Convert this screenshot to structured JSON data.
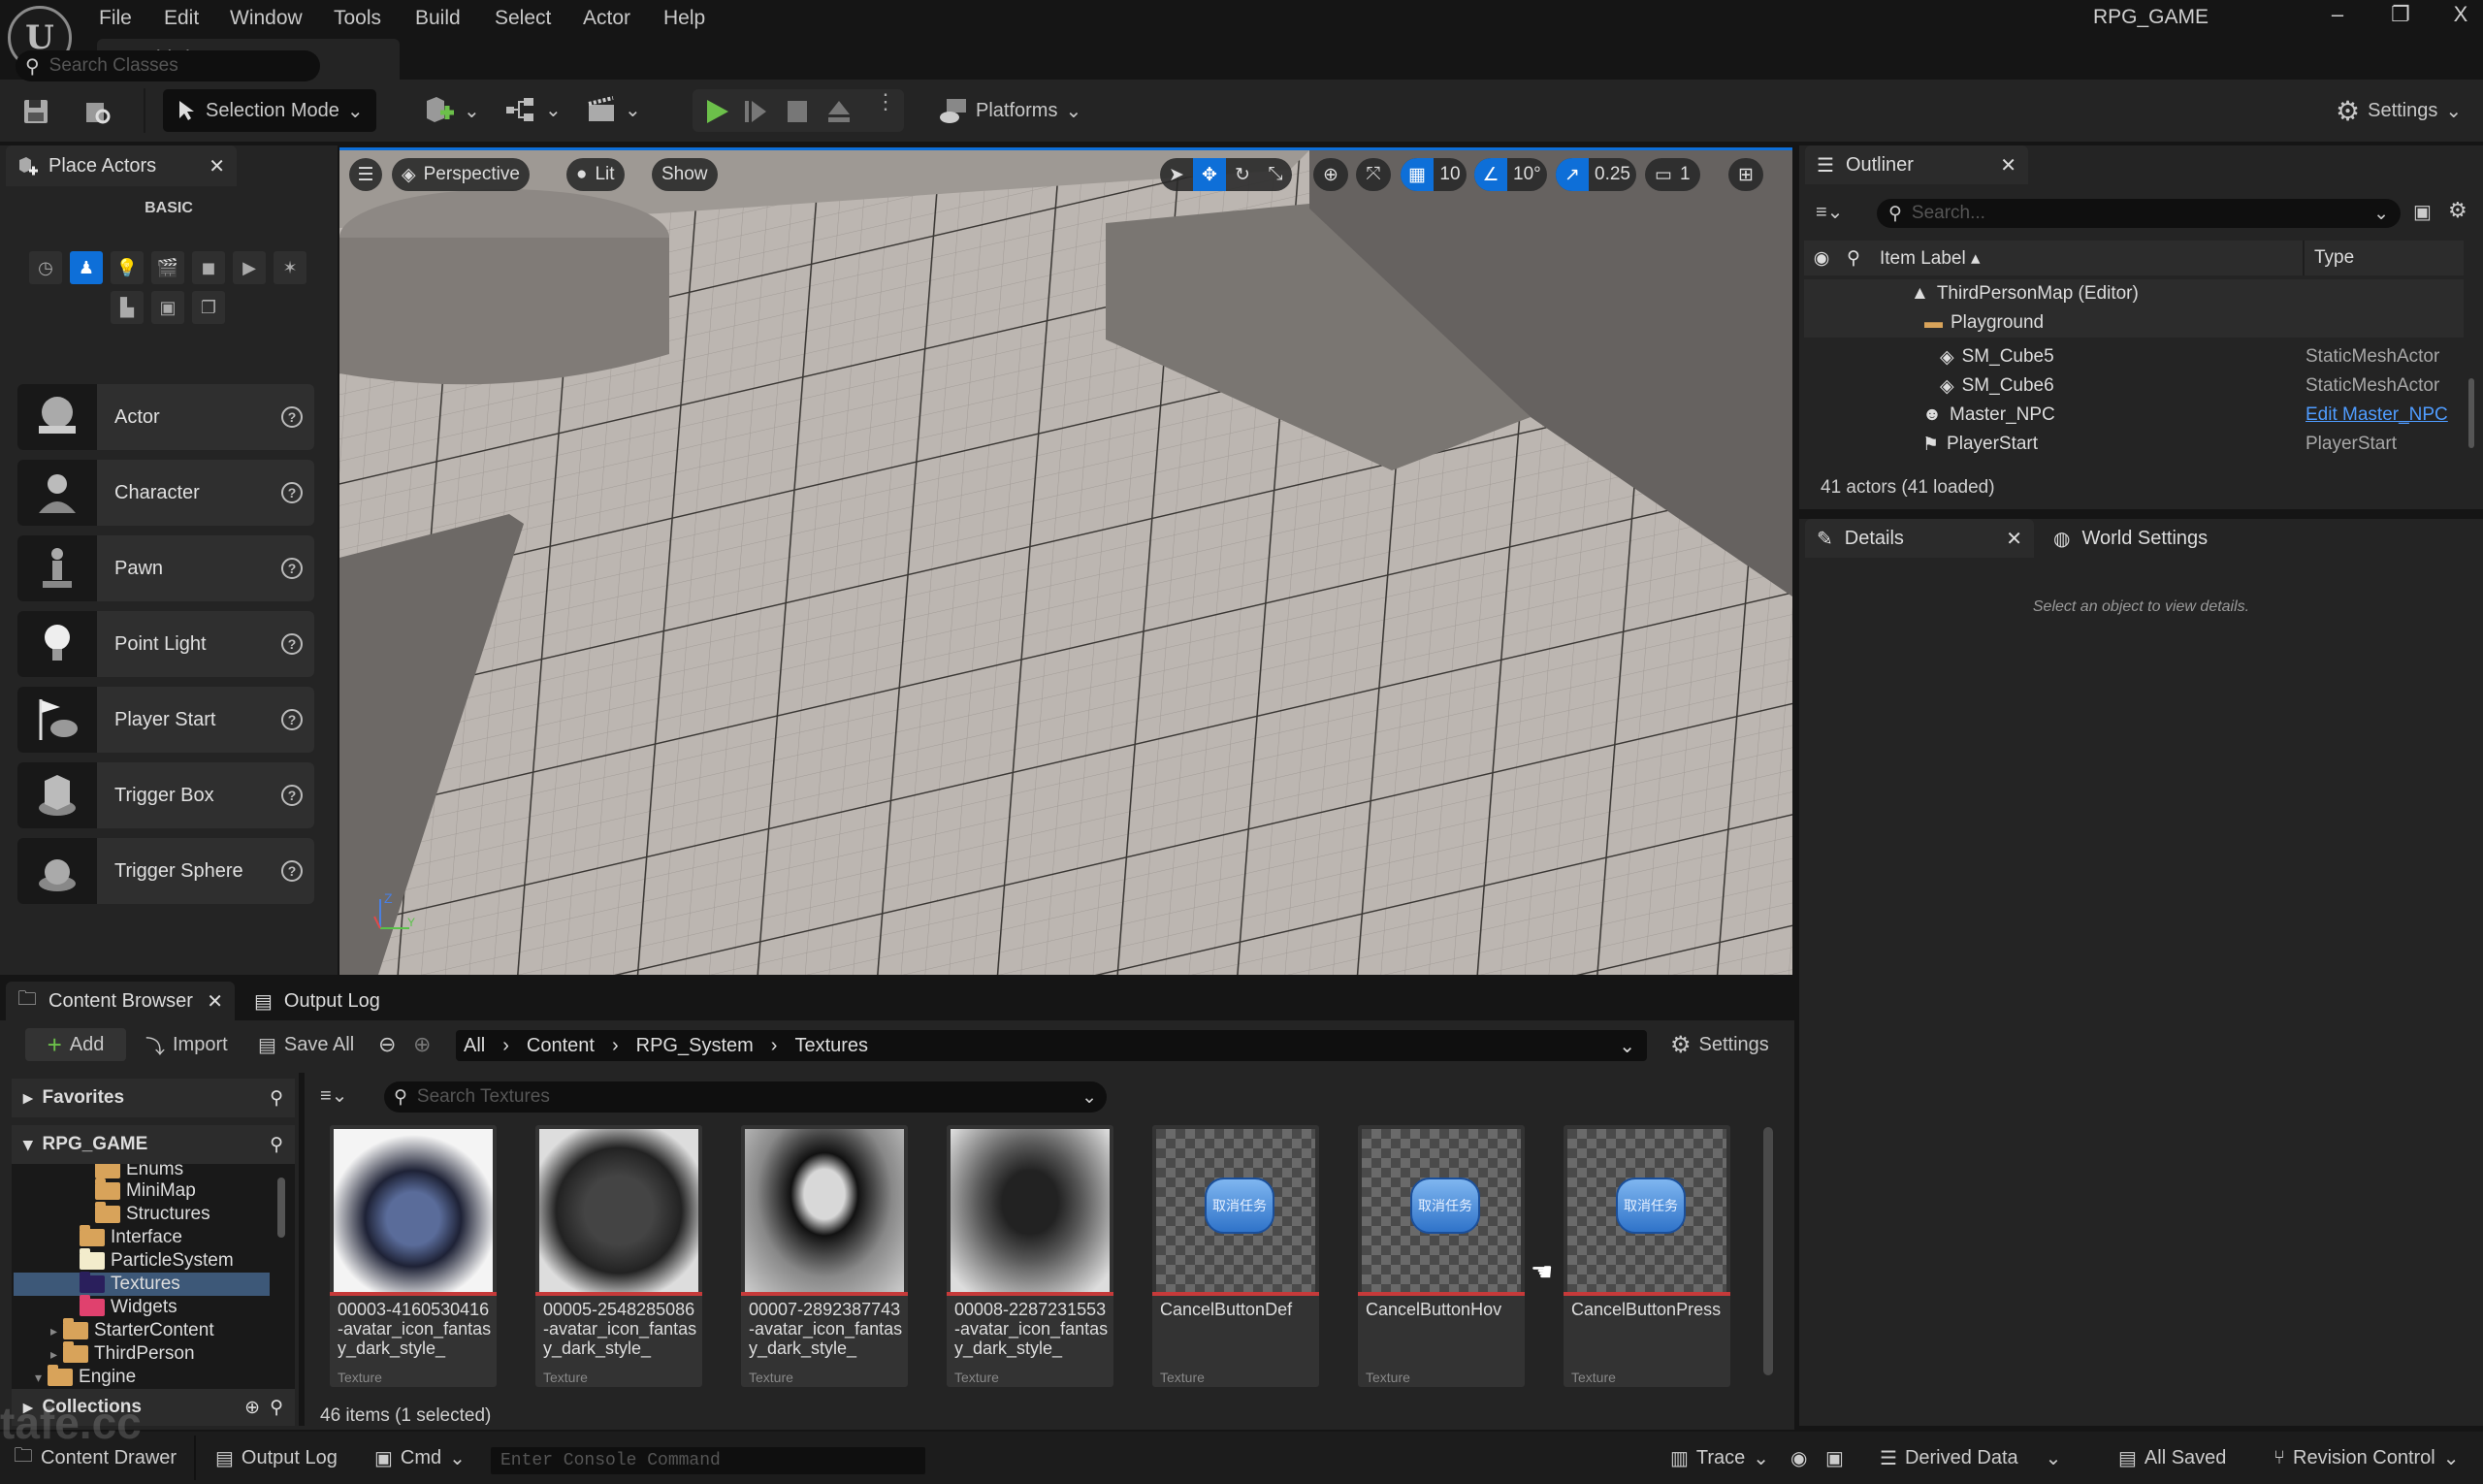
{
  "window": {
    "app_title": "RPG_GAME",
    "map_tab": "ThirdPersonMap",
    "controls": {
      "minimize": "–",
      "restore": "❐",
      "close": "X"
    }
  },
  "menu": [
    "File",
    "Edit",
    "Window",
    "Tools",
    "Build",
    "Select",
    "Actor",
    "Help"
  ],
  "toolbar": {
    "selection_mode": "Selection Mode",
    "platforms": "Platforms",
    "settings": "Settings"
  },
  "place_actors": {
    "title": "Place Actors",
    "search_placeholder": "Search Classes",
    "category_label": "BASIC",
    "categories": [
      "recent",
      "basic",
      "lights",
      "cinematic",
      "visual-effects",
      "volumes",
      "all-classes",
      "geometry",
      "shapes",
      "place"
    ],
    "items": [
      {
        "label": "Actor",
        "icon": "sphere-icon"
      },
      {
        "label": "Character",
        "icon": "character-icon"
      },
      {
        "label": "Pawn",
        "icon": "pawn-icon"
      },
      {
        "label": "Point Light",
        "icon": "lightbulb-icon"
      },
      {
        "label": "Player Start",
        "icon": "player-start-icon"
      },
      {
        "label": "Trigger Box",
        "icon": "trigger-box-icon"
      },
      {
        "label": "Trigger Sphere",
        "icon": "trigger-sphere-icon"
      }
    ]
  },
  "viewport": {
    "view_mode": "Perspective",
    "lighting": "Lit",
    "show": "Show",
    "grid_snap": "10",
    "rotation_snap": "10°",
    "scale_snap": "0.25",
    "camera_speed": "1",
    "axis_labels": {
      "z": "Z",
      "y": "Y"
    }
  },
  "outliner": {
    "title": "Outliner",
    "search_placeholder": "Search...",
    "columns": {
      "label": "Item Label",
      "type": "Type"
    },
    "rows": [
      {
        "label": "ThirdPersonMap (Editor)",
        "type": "",
        "icon": "map-icon"
      },
      {
        "label": "Playground",
        "type": "",
        "icon": "folder-icon"
      },
      {
        "label": "SM_Cube5",
        "type": "StaticMeshActor",
        "icon": "static-mesh-icon"
      },
      {
        "label": "SM_Cube6",
        "type": "StaticMeshActor",
        "icon": "static-mesh-icon"
      },
      {
        "label": "Master_NPC",
        "type": "Edit Master_NPC",
        "icon": "character-icon"
      },
      {
        "label": "PlayerStart",
        "type": "PlayerStart",
        "icon": "player-start-icon"
      }
    ],
    "actor_count": "41 actors (41 loaded)"
  },
  "details": {
    "tab": "Details",
    "world_settings_tab": "World Settings",
    "empty_message": "Select an object to view details."
  },
  "content_browser": {
    "tab": "Content Browser",
    "output_log_tab": "Output Log",
    "add": "Add",
    "import": "Import",
    "save_all": "Save All",
    "path": [
      "All",
      "Content",
      "RPG_System",
      "Textures"
    ],
    "settings": "Settings",
    "search_placeholder": "Search Textures",
    "favorites": "Favorites",
    "project": "RPG_GAME",
    "collections": "Collections",
    "tree": [
      {
        "label": "Enums",
        "color": "#d8a35a",
        "indent": 3
      },
      {
        "label": "MiniMap",
        "color": "#d8a35a",
        "indent": 3
      },
      {
        "label": "Structures",
        "color": "#d8a35a",
        "indent": 3
      },
      {
        "label": "Interface",
        "color": "#d8a35a",
        "indent": 2
      },
      {
        "label": "ParticleSystem",
        "color": "#f3eccc",
        "indent": 2
      },
      {
        "label": "Textures",
        "color": "#2a1f5c",
        "indent": 2,
        "selected": true
      },
      {
        "label": "Widgets",
        "color": "#e0416e",
        "indent": 2
      },
      {
        "label": "StarterContent",
        "color": "#d8a35a",
        "indent": 1,
        "expandable": true
      },
      {
        "label": "ThirdPerson",
        "color": "#d8a35a",
        "indent": 1,
        "expandable": true
      },
      {
        "label": "Engine",
        "color": "#d8a35a",
        "indent": 0,
        "expanded": true
      }
    ],
    "assets": [
      {
        "name": "00003-4160530416-avatar_icon_fantasy_dark_style_",
        "type": "Texture",
        "thumb": "avatar"
      },
      {
        "name": "00005-2548285086-avatar_icon_fantasy_dark_style_",
        "type": "Texture",
        "thumb": "avatar"
      },
      {
        "name": "00007-2892387743-avatar_icon_fantasy_dark_style_",
        "type": "Texture",
        "thumb": "avatar"
      },
      {
        "name": "00008-2287231553-avatar_icon_fantasy_dark_style_",
        "type": "Texture",
        "thumb": "avatar"
      },
      {
        "name": "CancelButtonDef",
        "type": "Texture",
        "thumb": "button",
        "button_text": "取消任务"
      },
      {
        "name": "CancelButtonHov",
        "type": "Texture",
        "thumb": "button",
        "button_text": "取消任务"
      },
      {
        "name": "CancelButtonPress",
        "type": "Texture",
        "thumb": "button",
        "button_text": "取消任务"
      }
    ],
    "item_count": "46 items (1 selected)"
  },
  "statusbar": {
    "content_drawer": "Content Drawer",
    "output_log": "Output Log",
    "cmd": "Cmd",
    "console_placeholder": "Enter Console Command",
    "trace": "Trace",
    "derived_data": "Derived Data",
    "all_saved": "All Saved",
    "revision_control": "Revision Control"
  },
  "watermark": "tafe.cc",
  "colors": {
    "accent": "#0e6fd8",
    "play": "#6cc04a",
    "asset_bar": "#c63a3a",
    "link": "#4f9cff"
  }
}
